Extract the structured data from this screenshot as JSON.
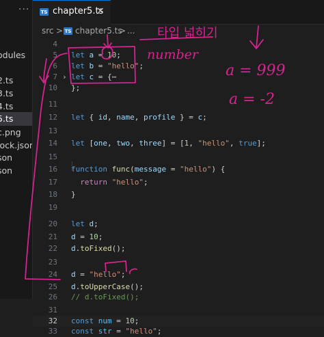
{
  "sidebar": {
    "more_label": "···",
    "items": [
      {
        "label": "odules",
        "active": false
      },
      {
        "label": "2.ts",
        "active": false
      },
      {
        "label": "3.ts",
        "active": false
      },
      {
        "label": "4.ts",
        "active": false
      },
      {
        "label": "5.ts",
        "active": true
      },
      {
        "label": "c.png",
        "active": false
      },
      {
        "label": "lock.json",
        "active": false
      },
      {
        "label": "son",
        "active": false
      },
      {
        "label": "son",
        "active": false
      }
    ]
  },
  "tab": {
    "label": "chapter5.ts",
    "badge": "TS",
    "close_label": "×"
  },
  "breadcrumb": {
    "src": "src",
    "sep1": ">",
    "file": "chapter5.ts",
    "sep2": ">",
    "more": "..."
  },
  "editor": {
    "lines": [
      {
        "num": "4",
        "tokens": []
      },
      {
        "num": "5",
        "tokens": [
          [
            "k",
            "let "
          ],
          [
            "v",
            "a"
          ],
          [
            "p",
            " = "
          ],
          [
            "n",
            "10"
          ],
          [
            "p",
            ";"
          ]
        ]
      },
      {
        "num": "6",
        "tokens": [
          [
            "k",
            "let "
          ],
          [
            "v",
            "b"
          ],
          [
            "p",
            " = "
          ],
          [
            "s",
            "\"hello\""
          ],
          [
            "p",
            ";"
          ]
        ]
      },
      {
        "num": "7",
        "tokens": [
          [
            "k",
            "let "
          ],
          [
            "v",
            "c"
          ],
          [
            "p",
            " = {"
          ],
          [
            "p",
            "⋯"
          ]
        ],
        "folded": true
      },
      {
        "num": "10",
        "tokens": [
          [
            "p",
            "};"
          ]
        ]
      },
      {
        "num": "11",
        "tokens": []
      },
      {
        "num": "12",
        "tokens": [
          [
            "k",
            "let "
          ],
          [
            "p",
            "{ "
          ],
          [
            "v",
            "id"
          ],
          [
            "p",
            ", "
          ],
          [
            "v",
            "name"
          ],
          [
            "p",
            ", "
          ],
          [
            "v",
            "profile"
          ],
          [
            "p",
            " } = "
          ],
          [
            "v",
            "c"
          ],
          [
            "p",
            ";"
          ]
        ]
      },
      {
        "num": "13",
        "tokens": []
      },
      {
        "num": "14",
        "tokens": [
          [
            "k",
            "let "
          ],
          [
            "p",
            "["
          ],
          [
            "v",
            "one"
          ],
          [
            "p",
            ", "
          ],
          [
            "v",
            "two"
          ],
          [
            "p",
            ", "
          ],
          [
            "v",
            "three"
          ],
          [
            "p",
            "] = ["
          ],
          [
            "n",
            "1"
          ],
          [
            "p",
            ", "
          ],
          [
            "s",
            "\"hello\""
          ],
          [
            "p",
            ", "
          ],
          [
            "k",
            "true"
          ],
          [
            "p",
            "];"
          ]
        ]
      },
      {
        "num": "15",
        "tokens": []
      },
      {
        "num": "16",
        "tokens": [
          [
            "k",
            "function "
          ],
          [
            "f",
            "func"
          ],
          [
            "p",
            "("
          ],
          [
            "v",
            "message"
          ],
          [
            "p",
            " = "
          ],
          [
            "s",
            "\"hello\""
          ],
          [
            "p",
            ") {"
          ]
        ]
      },
      {
        "num": "17",
        "tokens": [
          [
            "p",
            "  "
          ],
          [
            "ctl",
            "return "
          ],
          [
            "s",
            "\"hello\""
          ],
          [
            "p",
            ";"
          ]
        ]
      },
      {
        "num": "18",
        "tokens": [
          [
            "p",
            "}"
          ]
        ]
      },
      {
        "num": "19",
        "tokens": []
      },
      {
        "num": "20",
        "tokens": [
          [
            "k",
            "let "
          ],
          [
            "v",
            "d"
          ],
          [
            "p",
            ";"
          ]
        ]
      },
      {
        "num": "21",
        "tokens": [
          [
            "v",
            "d"
          ],
          [
            "p",
            " = "
          ],
          [
            "n",
            "10"
          ],
          [
            "p",
            ";"
          ]
        ]
      },
      {
        "num": "22",
        "tokens": [
          [
            "v",
            "d"
          ],
          [
            "p",
            "."
          ],
          [
            "f",
            "toFixed"
          ],
          [
            "p",
            "();"
          ]
        ]
      },
      {
        "num": "23",
        "tokens": []
      },
      {
        "num": "24",
        "tokens": [
          [
            "v",
            "d"
          ],
          [
            "p",
            " = "
          ],
          [
            "s",
            "\"hello\""
          ],
          [
            "p",
            ";"
          ]
        ]
      },
      {
        "num": "25",
        "tokens": [
          [
            "v",
            "d"
          ],
          [
            "p",
            "."
          ],
          [
            "f",
            "toUpperCase"
          ],
          [
            "p",
            "();"
          ]
        ]
      },
      {
        "num": "26",
        "tokens": [
          [
            "cm",
            "// d.toFixed();"
          ]
        ]
      },
      {
        "num": "31",
        "tokens": []
      },
      {
        "num": "32",
        "tokens": [
          [
            "k",
            "const "
          ],
          [
            "c",
            "num"
          ],
          [
            "p",
            " = "
          ],
          [
            "n",
            "10"
          ],
          [
            "p",
            ";"
          ]
        ],
        "current": true
      },
      {
        "num": "33",
        "tokens": [
          [
            "k",
            "const "
          ],
          [
            "c",
            "str"
          ],
          [
            "p",
            " = "
          ],
          [
            "s",
            "\"hello\""
          ],
          [
            "p",
            ";"
          ]
        ]
      },
      {
        "num": "34",
        "tokens": []
      }
    ]
  },
  "annotations": {
    "korean_note": "타입 넓히기",
    "number_note": "number",
    "value_note_1": "a = 999",
    "value_note_2": "a = -2",
    "ink_color": "#d6248f"
  }
}
